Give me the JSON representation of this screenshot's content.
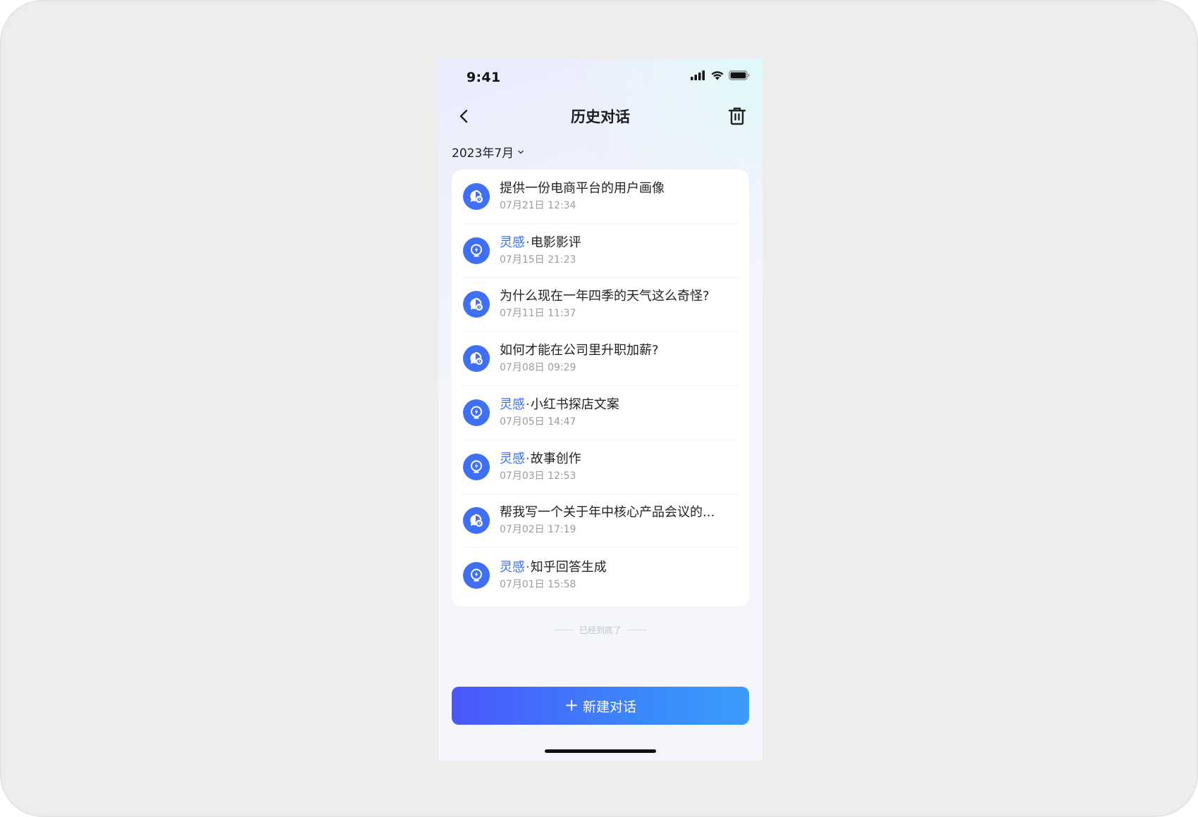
{
  "status_bar": {
    "time": "9:41"
  },
  "nav": {
    "title": "历史对话"
  },
  "filter": {
    "month": "2023年7月"
  },
  "conversations": [
    {
      "kind": "chat",
      "tag": "",
      "title": "提供一份电商平台的用户画像",
      "time": "07月21日 12:34"
    },
    {
      "kind": "inspiration",
      "tag": "灵感",
      "title": "电影影评",
      "time": "07月15日 21:23"
    },
    {
      "kind": "chat",
      "tag": "",
      "title": "为什么现在一年四季的天气这么奇怪?",
      "time": "07月11日 11:37"
    },
    {
      "kind": "chat",
      "tag": "",
      "title": "如何才能在公司里升职加薪?",
      "time": "07月08日 09:29"
    },
    {
      "kind": "inspiration",
      "tag": "灵感",
      "title": "小红书探店文案",
      "time": "07月05日 14:47"
    },
    {
      "kind": "inspiration",
      "tag": "灵感",
      "title": "故事创作",
      "time": "07月03日 12:53"
    },
    {
      "kind": "chat",
      "tag": "",
      "title": "帮我写一个关于年中核心产品会议的...",
      "time": "07月02日 17:19"
    },
    {
      "kind": "inspiration",
      "tag": "灵感",
      "title": "知乎回答生成",
      "time": "07月01日 15:58"
    }
  ],
  "footer": {
    "end_note": "已经到底了",
    "new_chat_label": "新建对话"
  },
  "icons": {
    "back": "chevron-left-icon",
    "trash": "trash-icon",
    "month_dropdown": "chevron-down-icon",
    "chat": "chat-bubble-icon",
    "inspiration": "lightbulb-bolt-icon",
    "plus": "plus-icon"
  },
  "colors": {
    "accent": "#3f6ff5",
    "tag": "#3b6ff3",
    "button_start": "#4a57fb",
    "button_end": "#3a9cfb"
  }
}
